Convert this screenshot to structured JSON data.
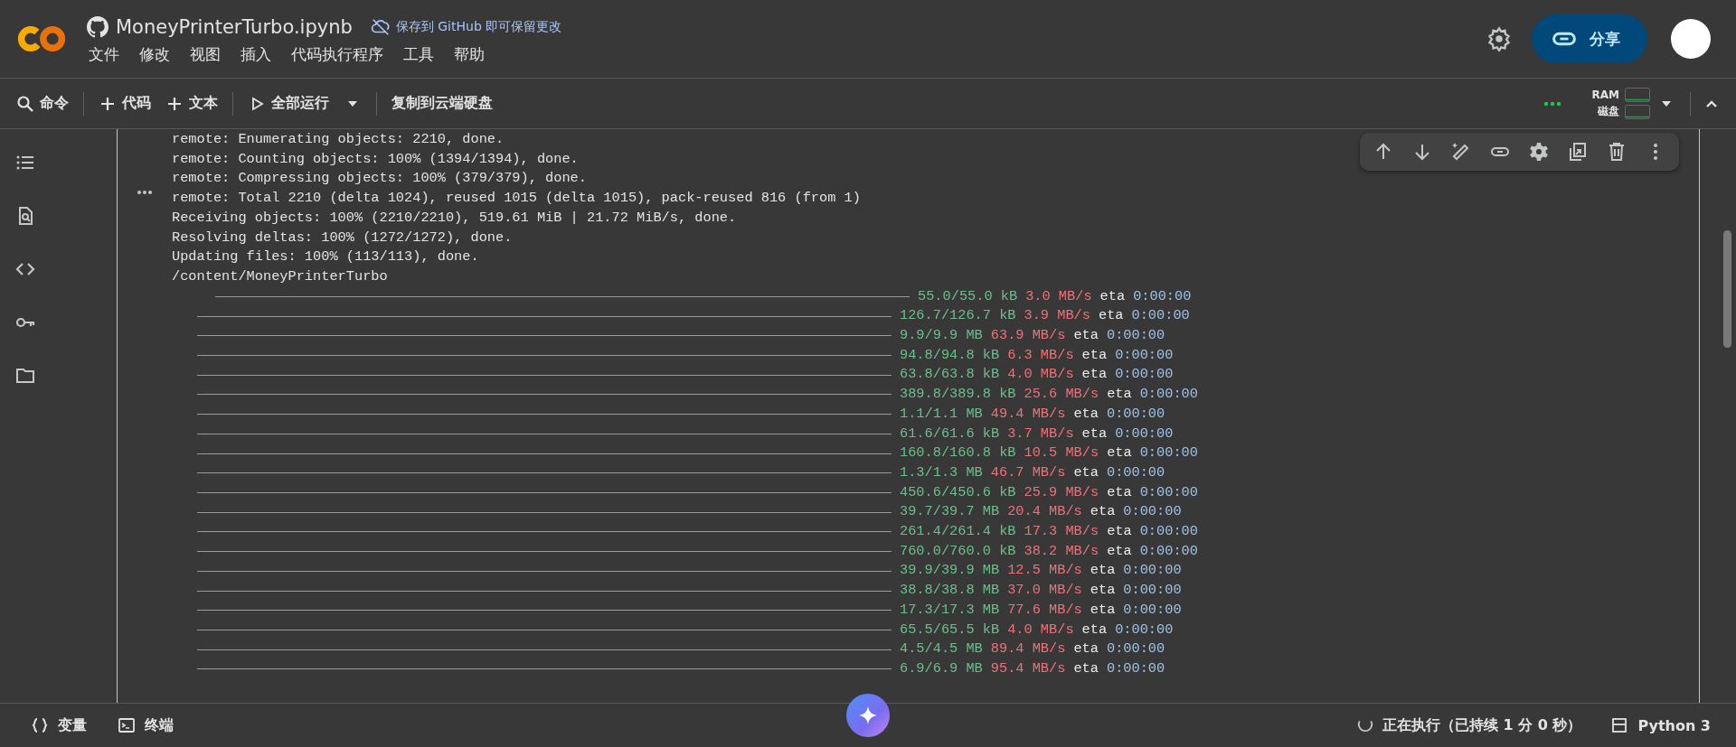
{
  "app": {
    "notebook_title": "MoneyPrinterTurbo.ipynb",
    "save_notice": "保存到 GitHub 即可保留更改",
    "share_label": "分享"
  },
  "menu": [
    "文件",
    "修改",
    "视图",
    "插入",
    "代码执行程序",
    "工具",
    "帮助"
  ],
  "toolbar": {
    "items": [
      {
        "kind": "search",
        "label": "命令"
      },
      {
        "kind": "add",
        "label": "代码"
      },
      {
        "kind": "add",
        "label": "文本"
      },
      {
        "kind": "run",
        "label": "全部运行"
      },
      {
        "kind": "plain",
        "label": "复制到云端硬盘"
      }
    ],
    "resources": [
      "RAM",
      "磁盘"
    ]
  },
  "output": {
    "log_lines": [
      "remote: Enumerating objects: 2210, done.",
      "remote: Counting objects: 100% (1394/1394), done.",
      "remote: Compressing objects: 100% (379/379), done.",
      "remote: Total 2210 (delta 1024), reused 1015 (delta 1015), pack-reused 816 (from 1)",
      "Receiving objects: 100% (2210/2210), 519.61 MiB | 21.72 MiB/s, done.",
      "Resolving deltas: 100% (1272/1272), done.",
      "Updating files: 100% (113/113), done.",
      "/content/MoneyPrinterTurbo"
    ],
    "progress_rows": [
      {
        "done": "55.0/55.0 kB",
        "speed": "3.0 MB/s",
        "eta_label": "eta",
        "eta": "0:00:00"
      },
      {
        "done": "126.7/126.7 kB",
        "speed": "3.9 MB/s",
        "eta_label": "eta",
        "eta": "0:00:00"
      },
      {
        "done": "9.9/9.9 MB",
        "speed": "63.9 MB/s",
        "eta_label": "eta",
        "eta": "0:00:00"
      },
      {
        "done": "94.8/94.8 kB",
        "speed": "6.3 MB/s",
        "eta_label": "eta",
        "eta": "0:00:00"
      },
      {
        "done": "63.8/63.8 kB",
        "speed": "4.0 MB/s",
        "eta_label": "eta",
        "eta": "0:00:00"
      },
      {
        "done": "389.8/389.8 kB",
        "speed": "25.6 MB/s",
        "eta_label": "eta",
        "eta": "0:00:00"
      },
      {
        "done": "1.1/1.1 MB",
        "speed": "49.4 MB/s",
        "eta_label": "eta",
        "eta": "0:00:00"
      },
      {
        "done": "61.6/61.6 kB",
        "speed": "3.7 MB/s",
        "eta_label": "eta",
        "eta": "0:00:00"
      },
      {
        "done": "160.8/160.8 kB",
        "speed": "10.5 MB/s",
        "eta_label": "eta",
        "eta": "0:00:00"
      },
      {
        "done": "1.3/1.3 MB",
        "speed": "46.7 MB/s",
        "eta_label": "eta",
        "eta": "0:00:00"
      },
      {
        "done": "450.6/450.6 kB",
        "speed": "25.9 MB/s",
        "eta_label": "eta",
        "eta": "0:00:00"
      },
      {
        "done": "39.7/39.7 MB",
        "speed": "20.4 MB/s",
        "eta_label": "eta",
        "eta": "0:00:00"
      },
      {
        "done": "261.4/261.4 kB",
        "speed": "17.3 MB/s",
        "eta_label": "eta",
        "eta": "0:00:00"
      },
      {
        "done": "760.0/760.0 kB",
        "speed": "38.2 MB/s",
        "eta_label": "eta",
        "eta": "0:00:00"
      },
      {
        "done": "39.9/39.9 MB",
        "speed": "12.5 MB/s",
        "eta_label": "eta",
        "eta": "0:00:00"
      },
      {
        "done": "38.8/38.8 MB",
        "speed": "37.0 MB/s",
        "eta_label": "eta",
        "eta": "0:00:00"
      },
      {
        "done": "17.3/17.3 MB",
        "speed": "77.6 MB/s",
        "eta_label": "eta",
        "eta": "0:00:00"
      },
      {
        "done": "65.5/65.5 kB",
        "speed": "4.0 MB/s",
        "eta_label": "eta",
        "eta": "0:00:00"
      },
      {
        "done": "4.5/4.5 MB",
        "speed": "89.4 MB/s",
        "eta_label": "eta",
        "eta": "0:00:00"
      },
      {
        "done": "6.9/6.9 MB",
        "speed": "95.4 MB/s",
        "eta_label": "eta",
        "eta": "0:00:00"
      }
    ]
  },
  "status_bar": {
    "tools": [
      {
        "kind": "variables",
        "label": "变量"
      },
      {
        "kind": "terminal",
        "label": "终端"
      }
    ],
    "status": "正在执行（已持续 1 分 0 秒）",
    "runtime": "Python 3"
  }
}
